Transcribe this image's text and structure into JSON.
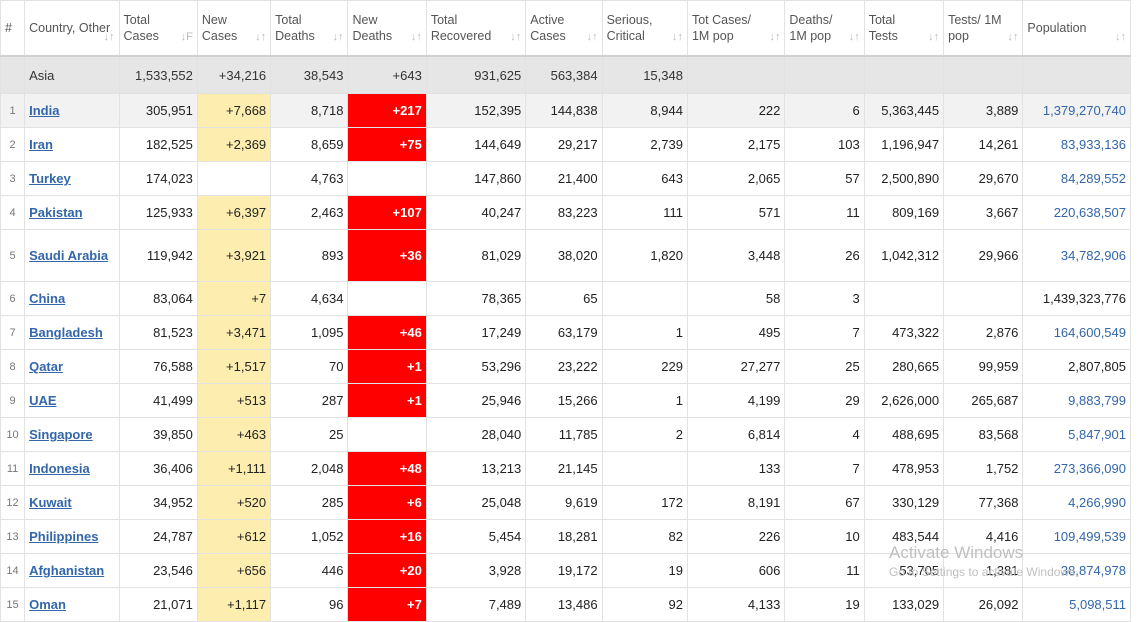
{
  "headers": [
    {
      "label": "#",
      "sort": ""
    },
    {
      "label": "Country, Other",
      "sort": "↓↑"
    },
    {
      "label": "Total Cases",
      "sort": "↓F"
    },
    {
      "label": "New Cases",
      "sort": "↓↑"
    },
    {
      "label": "Total Deaths",
      "sort": "↓↑"
    },
    {
      "label": "New Deaths",
      "sort": "↓↑"
    },
    {
      "label": "Total Recovered",
      "sort": "↓↑"
    },
    {
      "label": "Active Cases",
      "sort": "↓↑"
    },
    {
      "label": "Serious, Critical",
      "sort": "↓↑"
    },
    {
      "label": "Tot Cases/ 1M pop",
      "sort": "↓↑"
    },
    {
      "label": "Deaths/ 1M pop",
      "sort": "↓↑"
    },
    {
      "label": "Total Tests",
      "sort": "↓↑"
    },
    {
      "label": "Tests/ 1M pop",
      "sort": "↓↑"
    },
    {
      "label": "Population",
      "sort": "↓↑"
    }
  ],
  "continent_row": {
    "idx": "",
    "country": "Asia",
    "total_cases": "1,533,552",
    "new_cases": "+34,216",
    "total_deaths": "38,543",
    "new_deaths": "+643",
    "total_recovered": "931,625",
    "active_cases": "563,384",
    "serious": "15,348",
    "cases_per_1m": "",
    "deaths_per_1m": "",
    "total_tests": "",
    "tests_per_1m": "",
    "population": ""
  },
  "rows": [
    {
      "idx": "1",
      "country": "India",
      "total_cases": "305,951",
      "new_cases": "+7,668",
      "total_deaths": "8,718",
      "new_deaths": "+217",
      "total_recovered": "152,395",
      "active_cases": "144,838",
      "serious": "8,944",
      "cases_per_1m": "222",
      "deaths_per_1m": "6",
      "total_tests": "5,363,445",
      "tests_per_1m": "3,889",
      "population": "1,379,270,740",
      "pop_link": true
    },
    {
      "idx": "2",
      "country": "Iran",
      "total_cases": "182,525",
      "new_cases": "+2,369",
      "total_deaths": "8,659",
      "new_deaths": "+75",
      "total_recovered": "144,649",
      "active_cases": "29,217",
      "serious": "2,739",
      "cases_per_1m": "2,175",
      "deaths_per_1m": "103",
      "total_tests": "1,196,947",
      "tests_per_1m": "14,261",
      "population": "83,933,136",
      "pop_link": true
    },
    {
      "idx": "3",
      "country": "Turkey",
      "total_cases": "174,023",
      "new_cases": "",
      "total_deaths": "4,763",
      "new_deaths": "",
      "total_recovered": "147,860",
      "active_cases": "21,400",
      "serious": "643",
      "cases_per_1m": "2,065",
      "deaths_per_1m": "57",
      "total_tests": "2,500,890",
      "tests_per_1m": "29,670",
      "population": "84,289,552",
      "pop_link": true
    },
    {
      "idx": "4",
      "country": "Pakistan",
      "total_cases": "125,933",
      "new_cases": "+6,397",
      "total_deaths": "2,463",
      "new_deaths": "+107",
      "total_recovered": "40,247",
      "active_cases": "83,223",
      "serious": "111",
      "cases_per_1m": "571",
      "deaths_per_1m": "11",
      "total_tests": "809,169",
      "tests_per_1m": "3,667",
      "population": "220,638,507",
      "pop_link": true
    },
    {
      "idx": "5",
      "country": "Saudi Arabia",
      "total_cases": "119,942",
      "new_cases": "+3,921",
      "total_deaths": "893",
      "new_deaths": "+36",
      "total_recovered": "81,029",
      "active_cases": "38,020",
      "serious": "1,820",
      "cases_per_1m": "3,448",
      "deaths_per_1m": "26",
      "total_tests": "1,042,312",
      "tests_per_1m": "29,966",
      "population": "34,782,906",
      "pop_link": true
    },
    {
      "idx": "6",
      "country": "China",
      "total_cases": "83,064",
      "new_cases": "+7",
      "total_deaths": "4,634",
      "new_deaths": "",
      "total_recovered": "78,365",
      "active_cases": "65",
      "serious": "",
      "cases_per_1m": "58",
      "deaths_per_1m": "3",
      "total_tests": "",
      "tests_per_1m": "",
      "population": "1,439,323,776",
      "pop_link": false
    },
    {
      "idx": "7",
      "country": "Bangladesh",
      "total_cases": "81,523",
      "new_cases": "+3,471",
      "total_deaths": "1,095",
      "new_deaths": "+46",
      "total_recovered": "17,249",
      "active_cases": "63,179",
      "serious": "1",
      "cases_per_1m": "495",
      "deaths_per_1m": "7",
      "total_tests": "473,322",
      "tests_per_1m": "2,876",
      "population": "164,600,549",
      "pop_link": true
    },
    {
      "idx": "8",
      "country": "Qatar",
      "total_cases": "76,588",
      "new_cases": "+1,517",
      "total_deaths": "70",
      "new_deaths": "+1",
      "total_recovered": "53,296",
      "active_cases": "23,222",
      "serious": "229",
      "cases_per_1m": "27,277",
      "deaths_per_1m": "25",
      "total_tests": "280,665",
      "tests_per_1m": "99,959",
      "population": "2,807,805",
      "pop_link": false
    },
    {
      "idx": "9",
      "country": "UAE",
      "total_cases": "41,499",
      "new_cases": "+513",
      "total_deaths": "287",
      "new_deaths": "+1",
      "total_recovered": "25,946",
      "active_cases": "15,266",
      "serious": "1",
      "cases_per_1m": "4,199",
      "deaths_per_1m": "29",
      "total_tests": "2,626,000",
      "tests_per_1m": "265,687",
      "population": "9,883,799",
      "pop_link": true
    },
    {
      "idx": "10",
      "country": "Singapore",
      "total_cases": "39,850",
      "new_cases": "+463",
      "total_deaths": "25",
      "new_deaths": "",
      "total_recovered": "28,040",
      "active_cases": "11,785",
      "serious": "2",
      "cases_per_1m": "6,814",
      "deaths_per_1m": "4",
      "total_tests": "488,695",
      "tests_per_1m": "83,568",
      "population": "5,847,901",
      "pop_link": true
    },
    {
      "idx": "11",
      "country": "Indonesia",
      "total_cases": "36,406",
      "new_cases": "+1,111",
      "total_deaths": "2,048",
      "new_deaths": "+48",
      "total_recovered": "13,213",
      "active_cases": "21,145",
      "serious": "",
      "cases_per_1m": "133",
      "deaths_per_1m": "7",
      "total_tests": "478,953",
      "tests_per_1m": "1,752",
      "population": "273,366,090",
      "pop_link": true
    },
    {
      "idx": "12",
      "country": "Kuwait",
      "total_cases": "34,952",
      "new_cases": "+520",
      "total_deaths": "285",
      "new_deaths": "+6",
      "total_recovered": "25,048",
      "active_cases": "9,619",
      "serious": "172",
      "cases_per_1m": "8,191",
      "deaths_per_1m": "67",
      "total_tests": "330,129",
      "tests_per_1m": "77,368",
      "population": "4,266,990",
      "pop_link": true
    },
    {
      "idx": "13",
      "country": "Philippines",
      "total_cases": "24,787",
      "new_cases": "+612",
      "total_deaths": "1,052",
      "new_deaths": "+16",
      "total_recovered": "5,454",
      "active_cases": "18,281",
      "serious": "82",
      "cases_per_1m": "226",
      "deaths_per_1m": "10",
      "total_tests": "483,544",
      "tests_per_1m": "4,416",
      "population": "109,499,539",
      "pop_link": true
    },
    {
      "idx": "14",
      "country": "Afghanistan",
      "total_cases": "23,546",
      "new_cases": "+656",
      "total_deaths": "446",
      "new_deaths": "+20",
      "total_recovered": "3,928",
      "active_cases": "19,172",
      "serious": "19",
      "cases_per_1m": "606",
      "deaths_per_1m": "11",
      "total_tests": "53,705",
      "tests_per_1m": "1,381",
      "population": "38,874,978",
      "pop_link": true
    },
    {
      "idx": "15",
      "country": "Oman",
      "total_cases": "21,071",
      "new_cases": "+1,117",
      "total_deaths": "96",
      "new_deaths": "+7",
      "total_recovered": "7,489",
      "active_cases": "13,486",
      "serious": "92",
      "cases_per_1m": "4,133",
      "deaths_per_1m": "19",
      "total_tests": "133,029",
      "tests_per_1m": "26,092",
      "population": "5,098,511",
      "pop_link": true
    }
  ],
  "watermark": {
    "title": "Activate Windows",
    "subtitle": "Go to Settings to activate Windows."
  },
  "colors": {
    "new_cases_bg": "#fdeeb0",
    "new_deaths_bg": "#ff0000",
    "link": "#3366aa",
    "continent_bg": "#e6e6e6"
  }
}
